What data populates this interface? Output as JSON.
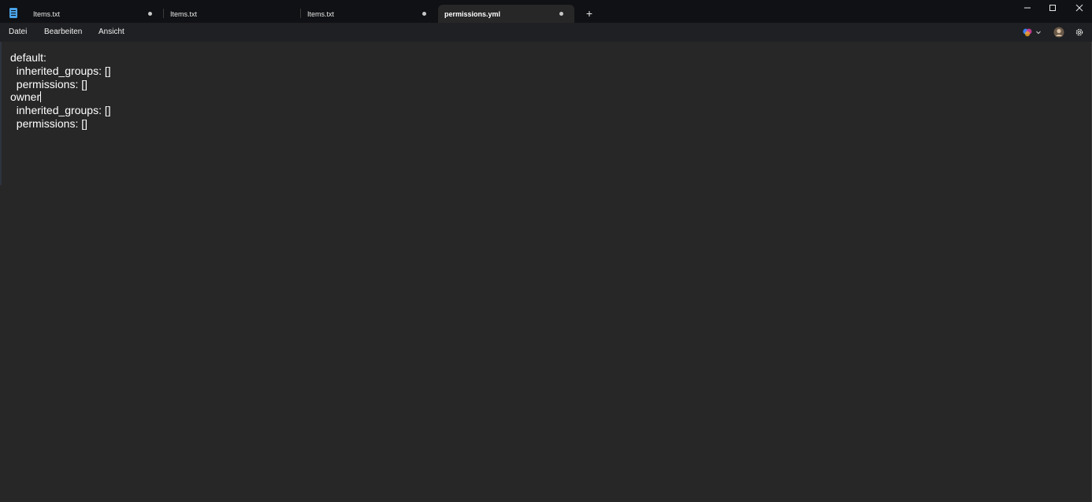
{
  "tabs": [
    {
      "label": "Items.txt",
      "unsaved": true,
      "active": false
    },
    {
      "label": "Items.txt",
      "unsaved": false,
      "active": false
    },
    {
      "label": "Items.txt",
      "unsaved": true,
      "active": false
    },
    {
      "label": "permissions.yml",
      "unsaved": true,
      "active": true
    }
  ],
  "new_tab_label": "+",
  "menu": {
    "file": "Datei",
    "edit": "Bearbeiten",
    "view": "Ansicht"
  },
  "editor": {
    "lines": [
      "default:",
      "  inherited_groups: []",
      "  permissions: []",
      "owner",
      "  inherited_groups: []",
      "  permissions: []"
    ],
    "caret_line": 3
  },
  "icons": {
    "app": "notepad-icon",
    "copilot": "copilot-icon",
    "profile": "avatar-icon",
    "settings": "gear-icon"
  },
  "colors": {
    "titlebar": "#0f1114",
    "menubar": "#1f2023",
    "editor_bg": "#272727",
    "text": "#ffffff",
    "app_icon": "#4aa3e8"
  }
}
